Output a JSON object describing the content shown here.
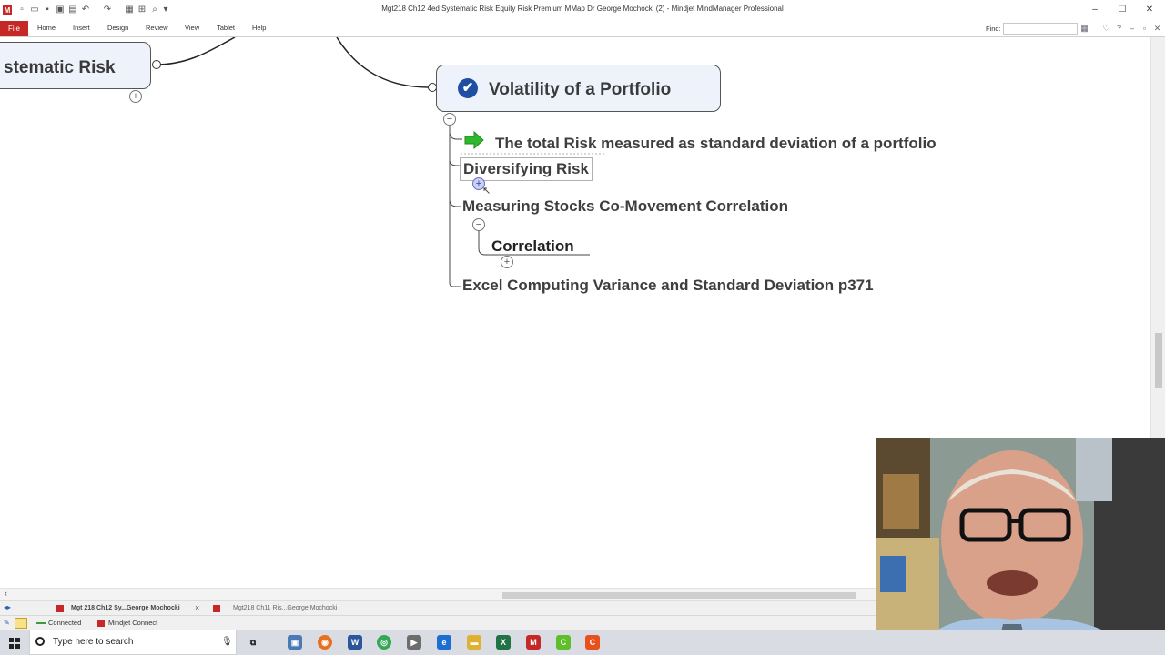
{
  "window": {
    "title": "Mgt218 Ch12 4ed Systematic Risk Equity Risk Premium MMap Dr George Mochocki (2) - Mindjet MindManager Professional",
    "controls": {
      "minimize": "–",
      "maximize": "☐",
      "close": "✕"
    }
  },
  "ribbon": {
    "file_label": "File",
    "tabs": [
      "Home",
      "Insert",
      "Design",
      "Review",
      "View",
      "Tablet",
      "Help"
    ],
    "find_label": "Find:",
    "find_value": ""
  },
  "map": {
    "left_topic": "stematic Risk",
    "main_topic": "Volatility of a Portfolio",
    "subtopics": [
      "The total Risk measured as standard deviation of a portfolio",
      "Diversifying Risk",
      "Measuring Stocks Co-Movement Correlation",
      "Correlation",
      "Excel Computing Variance and Standard Deviation p371"
    ],
    "expander_plus": "+",
    "expander_minus": "−"
  },
  "doc_tabs": [
    {
      "label": "Mgt 218 Ch12 Sy...George Mochocki",
      "active": true,
      "close": "×"
    },
    {
      "label": "Mgt218 Ch11 Ris...George Mochocki",
      "active": false
    }
  ],
  "statusbar": {
    "connected": "Connected",
    "mindjet_connect": "Mindjet Connect"
  },
  "taskbar": {
    "search_placeholder": "Type here to search"
  },
  "colors": {
    "file_tab": "#c62828",
    "topic_fill": "#eef3fb",
    "check_icon": "#1e4fa3",
    "arrow_icon": "#2eb82e",
    "taskbar": "#d9dde3"
  }
}
